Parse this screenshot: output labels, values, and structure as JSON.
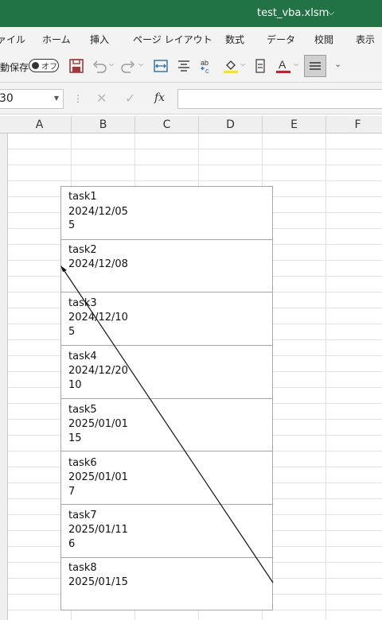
{
  "app": {
    "file_name": "test_vba.xlsm"
  },
  "ribbon": {
    "tabs": [
      "ァイル",
      "ホーム",
      "挿入",
      "ページ レイアウト",
      "数式",
      "データ",
      "校閲",
      "表示"
    ]
  },
  "toolbar": {
    "autosave_label": "動保存",
    "autosave_state": "オフ",
    "icons": [
      "save-icon",
      "undo-icon",
      "redo-icon",
      "merge-center-icon",
      "align-center-icon",
      "wrap-text-icon",
      "fill-color-icon",
      "cell-style-icon",
      "font-color-icon",
      "align-middle-icon",
      "more-icon"
    ],
    "fill_color_accent": "#ffe500",
    "font_color_accent": "#e81123"
  },
  "formula_bar": {
    "name_box": "30",
    "fx_label": "fx",
    "formula": ""
  },
  "columns": [
    "A",
    "B",
    "C",
    "D",
    "E",
    "F"
  ],
  "tasks": [
    {
      "name": "task1",
      "date": "2024/12/05",
      "value": "5"
    },
    {
      "name": "task2",
      "date": "2024/12/08",
      "value": ""
    },
    {
      "name": "task3",
      "date": "2024/12/10",
      "value": "5"
    },
    {
      "name": "task4",
      "date": "2024/12/20",
      "value": "10"
    },
    {
      "name": "task5",
      "date": "2025/01/01",
      "value": "15"
    },
    {
      "name": "task6",
      "date": "2025/01/01",
      "value": "7"
    },
    {
      "name": "task7",
      "date": "2025/01/11",
      "value": "6"
    },
    {
      "name": "task8",
      "date": "2025/01/15",
      "value": ""
    }
  ],
  "colors": {
    "title_bar": "#217346",
    "ribbon_bg": "#f3f3f3"
  }
}
